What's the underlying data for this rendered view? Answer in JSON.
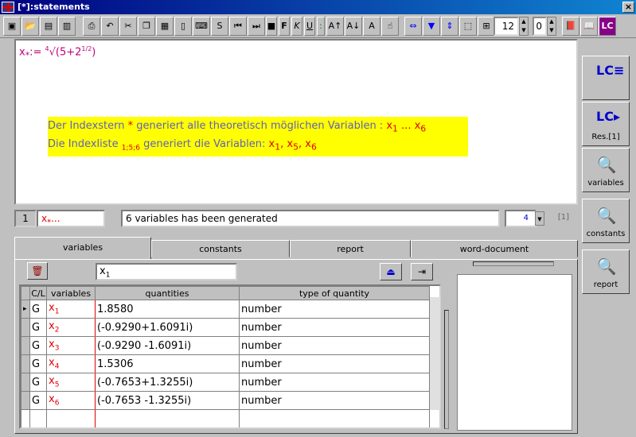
{
  "window": {
    "title": "[*]:statements",
    "close": "×"
  },
  "toolbar": {
    "font_size": "12",
    "digits": "0",
    "bold": "F",
    "italic": "K",
    "underline": "U"
  },
  "editor": {
    "formula_lhs": "x",
    "formula_sub": "*",
    "formula_rhs": ":= ",
    "formula_body": "√(5+2",
    "formula_root_idx": "4",
    "formula_exp": "1/2",
    "formula_close": ")",
    "note_line1_a": "Der Indexstern ",
    "note_line1_star": "*",
    "note_line1_b": " generiert alle theoretisch möglichen Variablen : ",
    "note_line1_vars": "x",
    "note_line1_sub1": "1",
    "note_line1_dots": " ... x",
    "note_line1_sub6": "6",
    "note_line2_a": "Die Indexliste ",
    "note_line2_list": "1;5;6",
    "note_line2_b": "  generiert die Variablen: ",
    "note_line2_vars": "x",
    "note_line2_s1": "1",
    "note_line2_v5": ", x",
    "note_line2_s5": "5",
    "note_line2_v6": ", x",
    "note_line2_s6": "6"
  },
  "statusbar": {
    "line_no": "1",
    "expr": "x",
    "expr_sub": "*",
    "expr_rest": "...",
    "message": "6 variables has been generated",
    "count": "4",
    "flag": "[1]"
  },
  "right_panel": {
    "btn2_label": "Res.[1]",
    "btn3_label": "variables",
    "btn4_label": "constants",
    "btn5_label": "report"
  },
  "tabs": [
    "variables",
    "constants",
    "report",
    "word-document"
  ],
  "filter": {
    "value": "x",
    "value_sub": "1"
  },
  "table": {
    "headers": [
      "C/L",
      "variables",
      "quantities",
      "type of quantity"
    ],
    "rows": [
      {
        "cl": "G",
        "var": "x",
        "sub": "1",
        "qty": "1.8580",
        "type": "number"
      },
      {
        "cl": "G",
        "var": "x",
        "sub": "2",
        "qty": "(-0.9290+1.6091i)",
        "type": "number"
      },
      {
        "cl": "G",
        "var": "x",
        "sub": "3",
        "qty": "(-0.9290  -1.6091i)",
        "type": "number"
      },
      {
        "cl": "G",
        "var": "x",
        "sub": "4",
        "qty": "1.5306",
        "type": "number"
      },
      {
        "cl": "G",
        "var": "x",
        "sub": "5",
        "qty": "(-0.7653+1.3255i)",
        "type": "number"
      },
      {
        "cl": "G",
        "var": "x",
        "sub": "6",
        "qty": "(-0.7653  -1.3255i)",
        "type": "number"
      }
    ]
  }
}
